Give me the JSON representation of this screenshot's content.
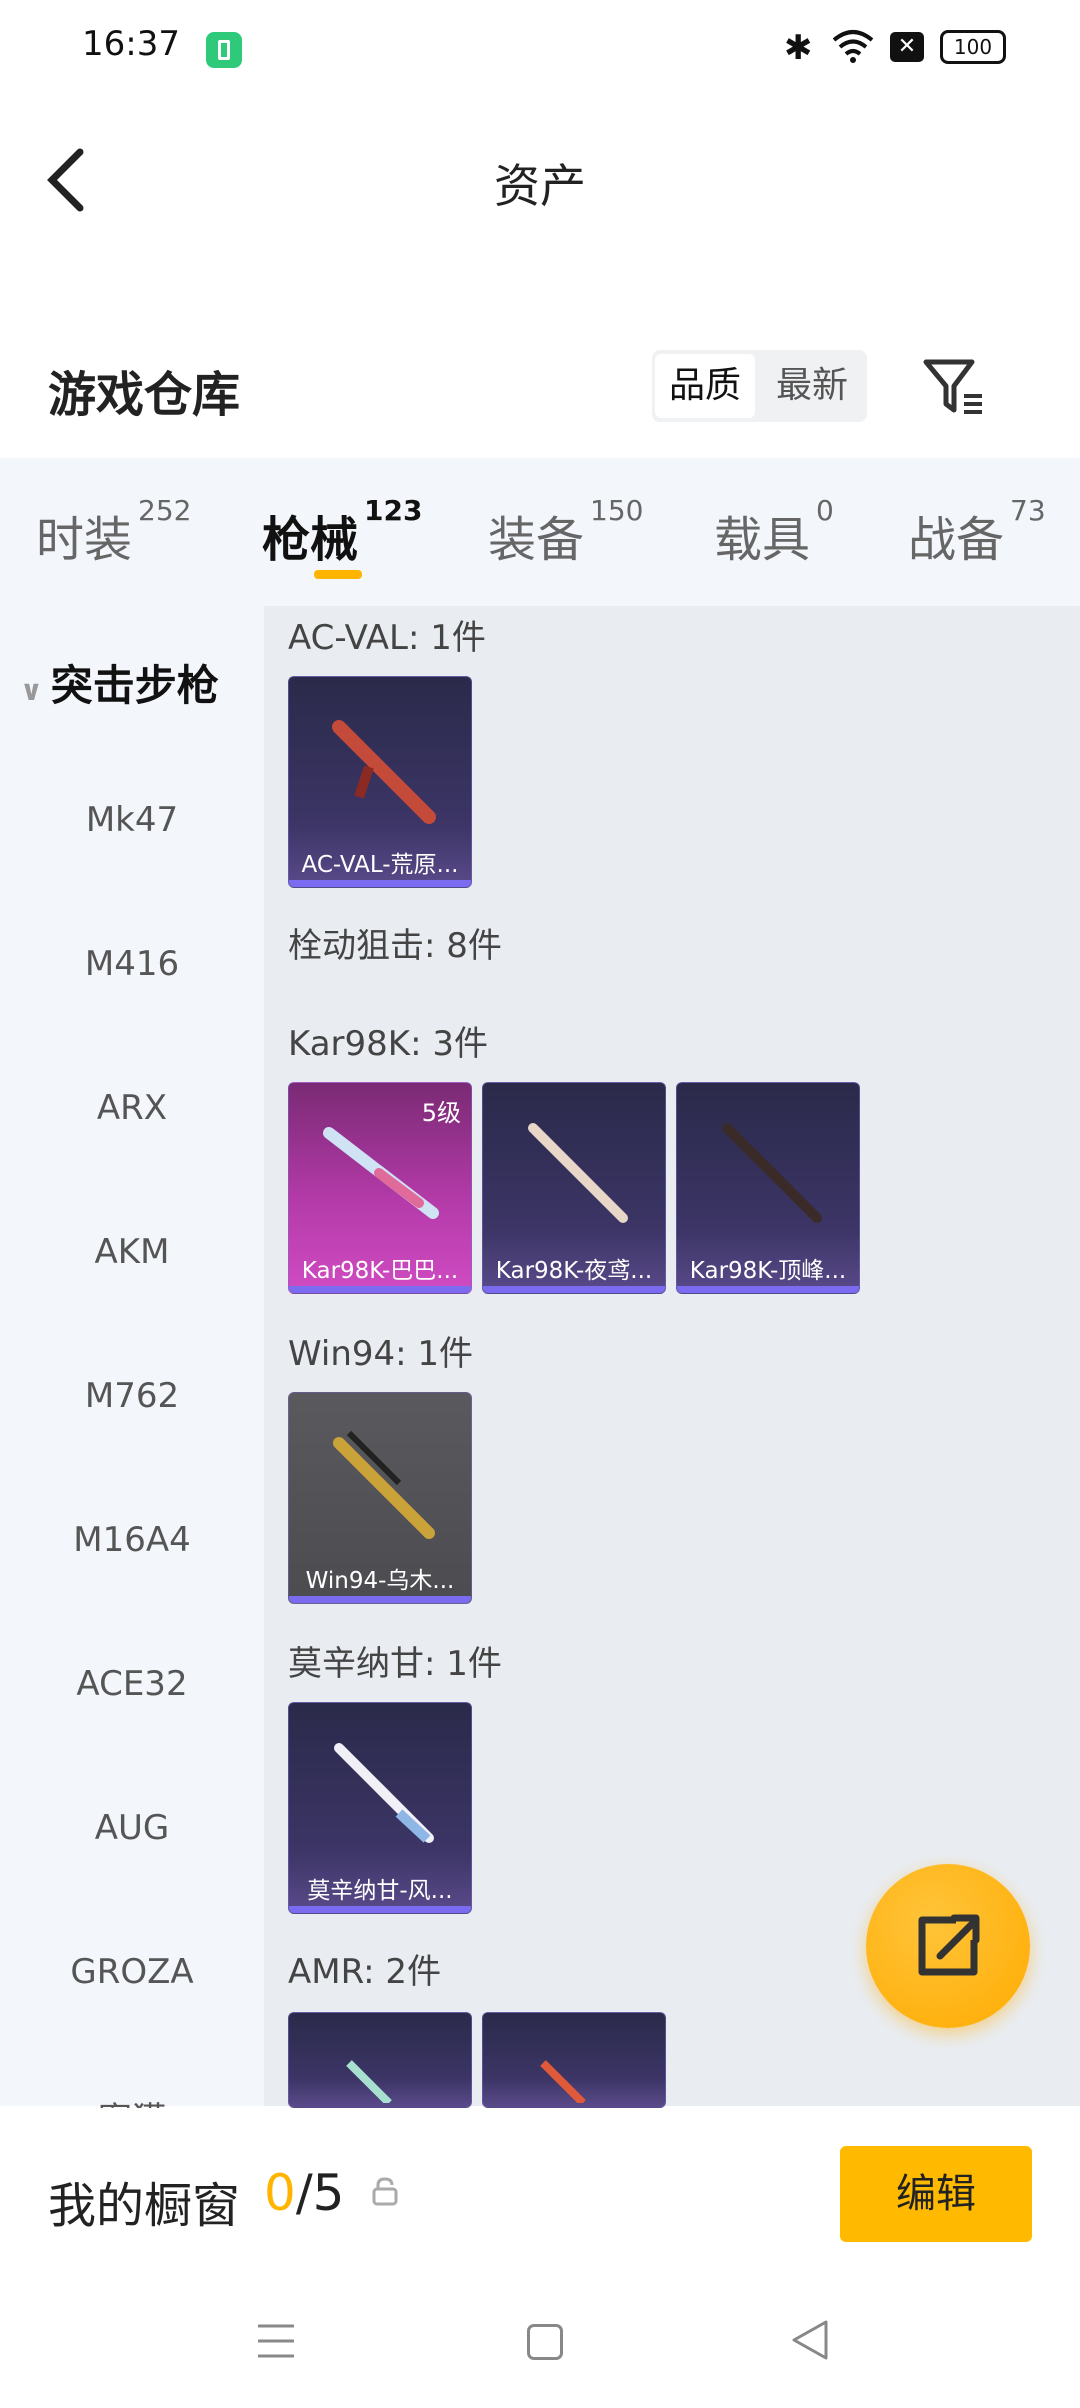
{
  "status_bar": {
    "time": "16:37",
    "battery": "100"
  },
  "header": {
    "title": "资产"
  },
  "warehouse": {
    "title": "游戏仓库",
    "sort_quality": "品质",
    "sort_newest": "最新"
  },
  "tabs": [
    {
      "label": "时装",
      "count": "252"
    },
    {
      "label": "枪械",
      "count": "123"
    },
    {
      "label": "装备",
      "count": "150"
    },
    {
      "label": "载具",
      "count": "0"
    },
    {
      "label": "战备",
      "count": "73"
    }
  ],
  "sidebar": {
    "header": "突击步枪",
    "items": [
      "Mk47",
      "M416",
      "ARX",
      "AKM",
      "M762",
      "M16A4",
      "ACE32",
      "AUG",
      "GROZA",
      "蜜獾"
    ]
  },
  "groups": {
    "acval": {
      "title": "AC-VAL: 1件",
      "items": [
        "AC-VAL-荒原..."
      ]
    },
    "bolt": {
      "title": "栓动狙击: 8件"
    },
    "kar98k": {
      "title": "Kar98K: 3件",
      "items": [
        "Kar98K-巴巴...",
        "Kar98K-夜鸢...",
        "Kar98K-顶峰..."
      ],
      "level": "5级"
    },
    "win94": {
      "title": "Win94: 1件",
      "items": [
        "Win94-乌木..."
      ]
    },
    "mosin": {
      "title": "莫辛纳甘: 1件",
      "items": [
        "莫辛纳甘-风..."
      ]
    },
    "amr": {
      "title": "AMR: 2件"
    }
  },
  "bottom": {
    "showcase_label": "我的橱窗",
    "showcase_current": "0",
    "showcase_total": "/5",
    "edit_label": "编辑"
  }
}
